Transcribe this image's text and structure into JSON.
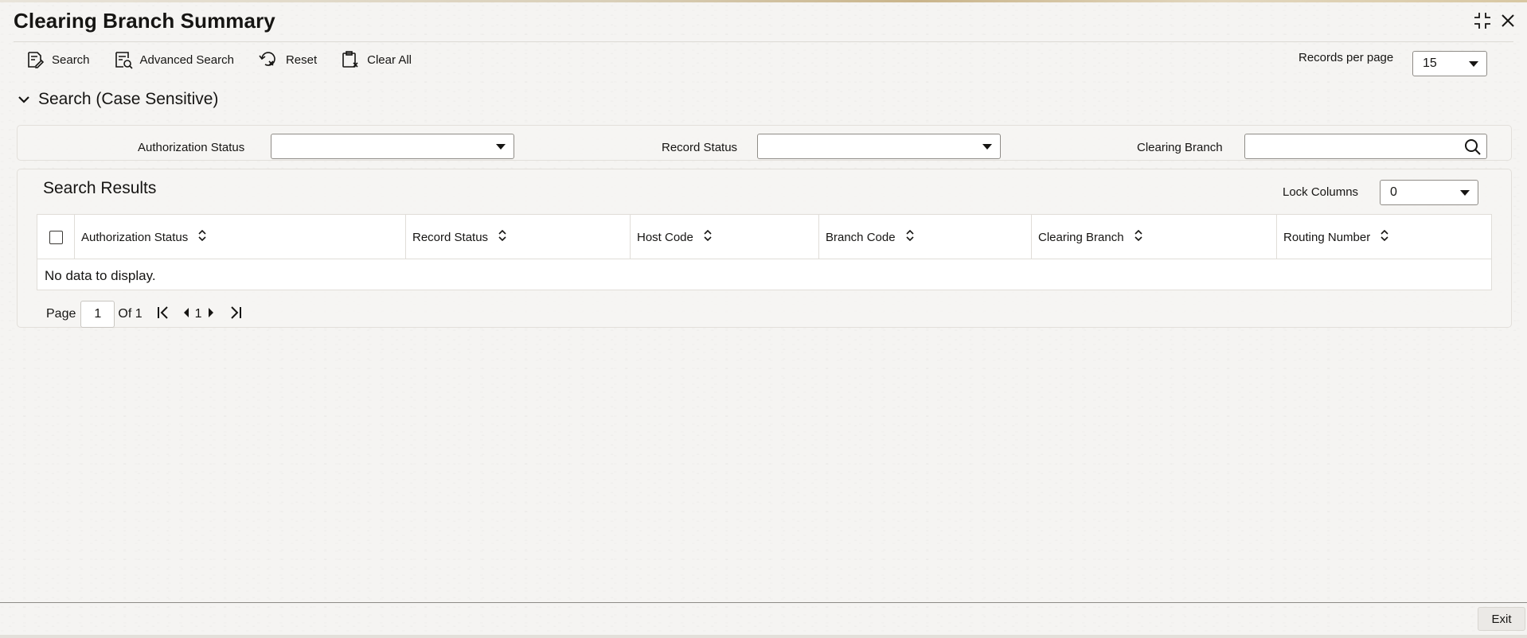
{
  "window": {
    "title": "Clearing Branch Summary"
  },
  "toolbar": {
    "search_label": "Search",
    "advanced_search_label": "Advanced Search",
    "reset_label": "Reset",
    "clear_all_label": "Clear All"
  },
  "records_per_page": {
    "label": "Records per page",
    "value": "15"
  },
  "search_section": {
    "title": "Search (Case Sensitive)",
    "authorization_status_label": "Authorization Status",
    "authorization_status_value": "",
    "record_status_label": "Record Status",
    "record_status_value": "",
    "clearing_branch_label": "Clearing Branch",
    "clearing_branch_value": ""
  },
  "results": {
    "title": "Search Results",
    "lock_columns_label": "Lock Columns",
    "lock_columns_value": "0",
    "columns": [
      "Authorization Status",
      "Record Status",
      "Host Code",
      "Branch Code",
      "Clearing Branch",
      "Routing Number"
    ],
    "empty_message": "No data to display."
  },
  "pagination": {
    "page_label": "Page",
    "current_page": "1",
    "of_label": "Of 1",
    "page_number": "1"
  },
  "footer": {
    "exit_label": "Exit"
  },
  "colors": {
    "accent": "#161513",
    "border": "#8f8c87",
    "panel": "#f6f5f3"
  }
}
